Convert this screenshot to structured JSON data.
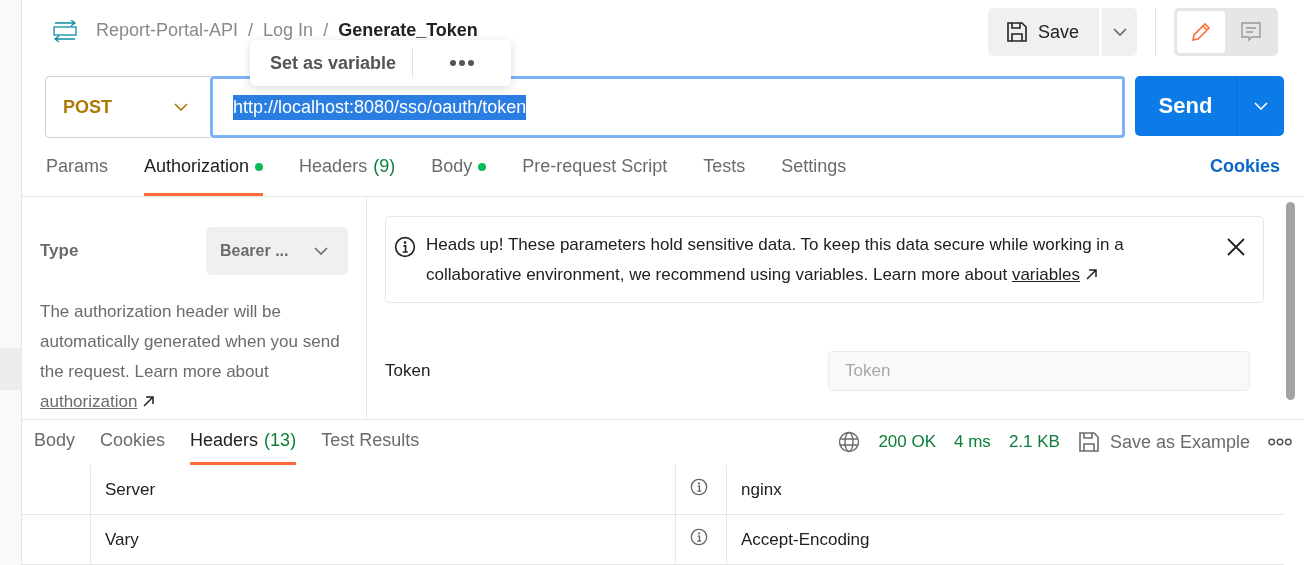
{
  "breadcrumb": [
    "Report-Portal-API",
    "Log In",
    "Generate_Token"
  ],
  "breadcrumb_separator": "/",
  "popup": {
    "label": "Set as variable"
  },
  "save_button": {
    "label": "Save"
  },
  "mode_toggle": [
    {
      "kind": "edit",
      "selected": true
    },
    {
      "kind": "comment",
      "selected": false
    }
  ],
  "request": {
    "method": "POST",
    "url": "http://localhost:8080/sso/oauth/token",
    "url_selected": true
  },
  "send_button": {
    "label": "Send"
  },
  "request_tabs": [
    {
      "label": "Params",
      "selected": false
    },
    {
      "label": "Authorization",
      "dot": true,
      "selected": true
    },
    {
      "label": "Headers",
      "count": "(9)",
      "selected": false
    },
    {
      "label": "Body",
      "dot": true,
      "selected": false
    },
    {
      "label": "Pre-request Script",
      "selected": false
    },
    {
      "label": "Tests",
      "selected": false
    },
    {
      "label": "Settings",
      "selected": false
    }
  ],
  "cookies_link": "Cookies",
  "auth": {
    "type_label": "Type",
    "type_value": "Bearer ...",
    "description": "The authorization header will be automatically generated when you send the request. Learn more about ",
    "description_link": "authorization"
  },
  "notice": {
    "text": "Heads up! These parameters hold sensitive data. To keep this data secure while working in a collaborative environment, we recommend using variables. Learn more about ",
    "link": "variables"
  },
  "token": {
    "label": "Token",
    "placeholder": "Token"
  },
  "response_tabs": [
    {
      "label": "Body",
      "selected": false
    },
    {
      "label": "Cookies",
      "selected": false
    },
    {
      "label": "Headers",
      "count": "(13)",
      "selected": true
    },
    {
      "label": "Test Results",
      "selected": false
    }
  ],
  "response_status": {
    "status": "200 OK",
    "time": "4 ms",
    "size": "2.1 KB"
  },
  "save_example": "Save as Example",
  "headers": [
    {
      "key": "Server",
      "value": "nginx"
    },
    {
      "key": "Vary",
      "value": "Accept-Encoding"
    }
  ]
}
